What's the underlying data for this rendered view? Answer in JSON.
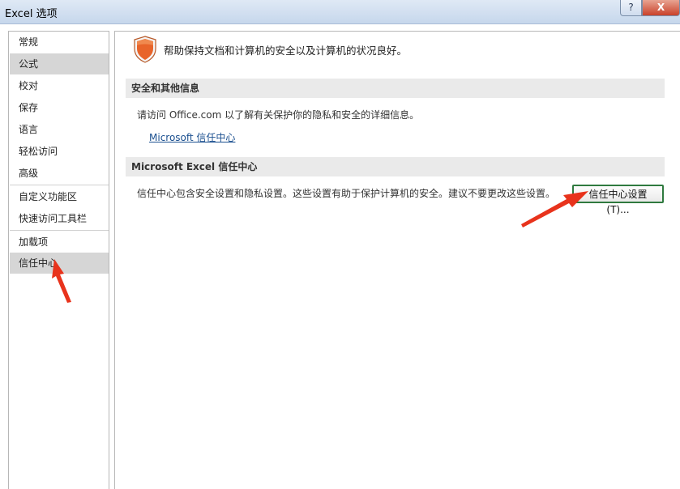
{
  "window": {
    "title": "Excel 选项",
    "help_label": "?",
    "close_label": "X"
  },
  "nav": {
    "items": [
      {
        "label": "常规"
      },
      {
        "label": "公式",
        "selected": true
      },
      {
        "label": "校对"
      },
      {
        "label": "保存"
      },
      {
        "label": "语言"
      },
      {
        "label": "轻松访问"
      },
      {
        "label": "高级"
      },
      {
        "label": "自定义功能区"
      },
      {
        "label": "快速访问工具栏"
      },
      {
        "label": "加载项"
      },
      {
        "label": "信任中心",
        "selected": true
      }
    ]
  },
  "main": {
    "header": "帮助保持文档和计算机的安全以及计算机的状况良好。",
    "privacy_section": {
      "title": "安全和其他信息",
      "text": "请访问 Office.com  以了解有关保护你的隐私和安全的详细信息。",
      "link": "Microsoft 信任中心"
    },
    "trust_section": {
      "title": "Microsoft Excel 信任中心",
      "text": "信任中心包含安全设置和隐私设置。这些设置有助于保护计算机的安全。建议不要更改这些设置。",
      "button": "信任中心设置(T)..."
    }
  },
  "colors": {
    "shield": "#e8642a",
    "selected_nav": "#d6d6d6",
    "arrow": "#e8331c",
    "button_border": "#2f7a3f"
  }
}
